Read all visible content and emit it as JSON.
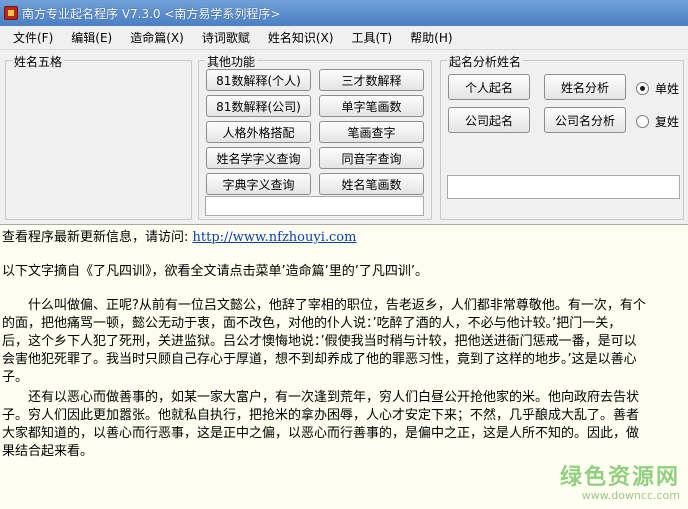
{
  "window": {
    "title": "南方专业起名程序 V7.3.0   <南方易学系列程序>"
  },
  "menu": [
    "文件(F)",
    "编辑(E)",
    "造命篇(X)",
    "诗词歌赋",
    "姓名知识(X)",
    "工具(T)",
    "帮助(H)"
  ],
  "panels": {
    "name_five": {
      "legend": "姓名五格"
    },
    "other": {
      "legend": "其他功能",
      "buttons": [
        "81数解释(个人)",
        "三才数解释",
        "81数解释(公司)",
        "单字笔画数",
        "人格外格搭配",
        "笔画查字",
        "姓名学字义查询",
        "同音字查询",
        "字典字义查询",
        "姓名笔画数"
      ],
      "input_value": ""
    },
    "analysis": {
      "legend": "起名分析姓名",
      "buttons": [
        "个人起名",
        "姓名分析",
        "公司起名",
        "公司名分析"
      ],
      "radios": [
        {
          "label": "单姓",
          "checked": true
        },
        {
          "label": "复姓",
          "checked": false
        }
      ],
      "input_value": ""
    }
  },
  "content": {
    "update_prefix": "查看程序最新更新信息，请访问: ",
    "update_url": "http://www.nfzhouyi.com",
    "excerpt_note": "以下文字摘自《了凡四训》，欲看全文请点击菜单’造命篇’里的’了凡四训’。",
    "lines": [
      "什么叫做偏、正呢?从前有一位吕文懿公，他辞了宰相的职位，告老返乡，人们都非常尊敬他。有一次，有个",
      "的面，把他痛骂一顿，懿公无动于衷，面不改色，对他的仆人说：’吃醉了酒的人，不必与他计较。’把门一关，",
      "后，这个乡下人犯了死刑，关进监狱。吕公才懊悔地说：’假使我当时稍与计较，把他送进衙门惩戒一番，是可以",
      "会害他犯死罪了。我当时只顾自己存心于厚道，想不到却养成了他的罪恶习性，竟到了这样的地步。’这是以善心",
      "子。",
      "还有以恶心而做善事的，如某一家大富户，有一次逢到荒年，穷人们白昼公开抢他家的米。他向政府去告状",
      "子。穷人们因此更加嚣张。他就私自执行，把抢米的拿办困辱，人心才安定下来；不然，几乎酿成大乱了。善者",
      "大家都知道的，以善心而行恶事，这是正中之偏，以恶心而行善事的，是偏中之正，这是人所不知的。因此，做",
      "果结合起来看。"
    ]
  },
  "watermark": {
    "main": "绿色资源网",
    "url": "www.downcc.com"
  }
}
